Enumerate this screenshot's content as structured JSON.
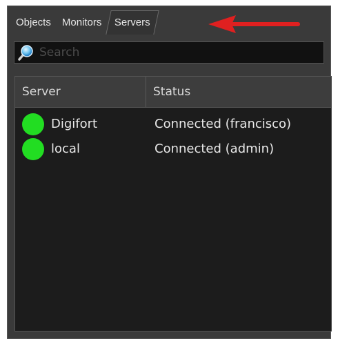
{
  "tabs": [
    {
      "label": "Objects",
      "active": false
    },
    {
      "label": "Monitors",
      "active": false
    },
    {
      "label": "Servers",
      "active": true
    }
  ],
  "annotation": {
    "icon": "red-arrow-icon",
    "color": "#e02020"
  },
  "search": {
    "placeholder": "Search",
    "value": "",
    "icon": "search-icon"
  },
  "table": {
    "columns": [
      "Server",
      "Status"
    ],
    "rows": [
      {
        "server": "Digifort",
        "status": "Connected (francisco)",
        "indicator_color": "#22dd22"
      },
      {
        "server": "local",
        "status": "Connected (admin)",
        "indicator_color": "#22dd22"
      }
    ]
  },
  "colors": {
    "panel_background": "#3a3a3a",
    "list_background": "#1c1c1c",
    "connected": "#22dd22",
    "text": "#e8e8e8"
  }
}
